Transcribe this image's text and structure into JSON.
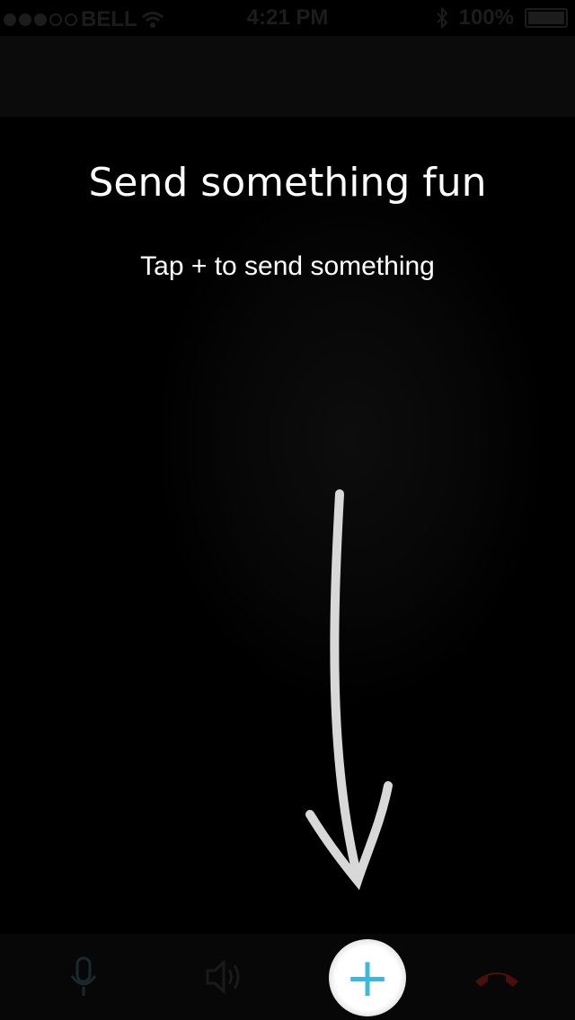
{
  "status_bar": {
    "carrier": "BELL",
    "time": "4:21 PM",
    "battery": "100%",
    "battery_level": 1.0,
    "signal_bars": 3,
    "signal_total": 5
  },
  "content": {
    "title": "Send something fun",
    "subtitle": "Tap + to send something"
  },
  "toolbar": {
    "mic_icon": "microphone-icon",
    "speaker_icon": "speaker-icon",
    "plus_label": "+",
    "plus_color": "#3bb8dc",
    "end_call_icon": "end-call-icon",
    "end_call_color": "#5a1010"
  }
}
